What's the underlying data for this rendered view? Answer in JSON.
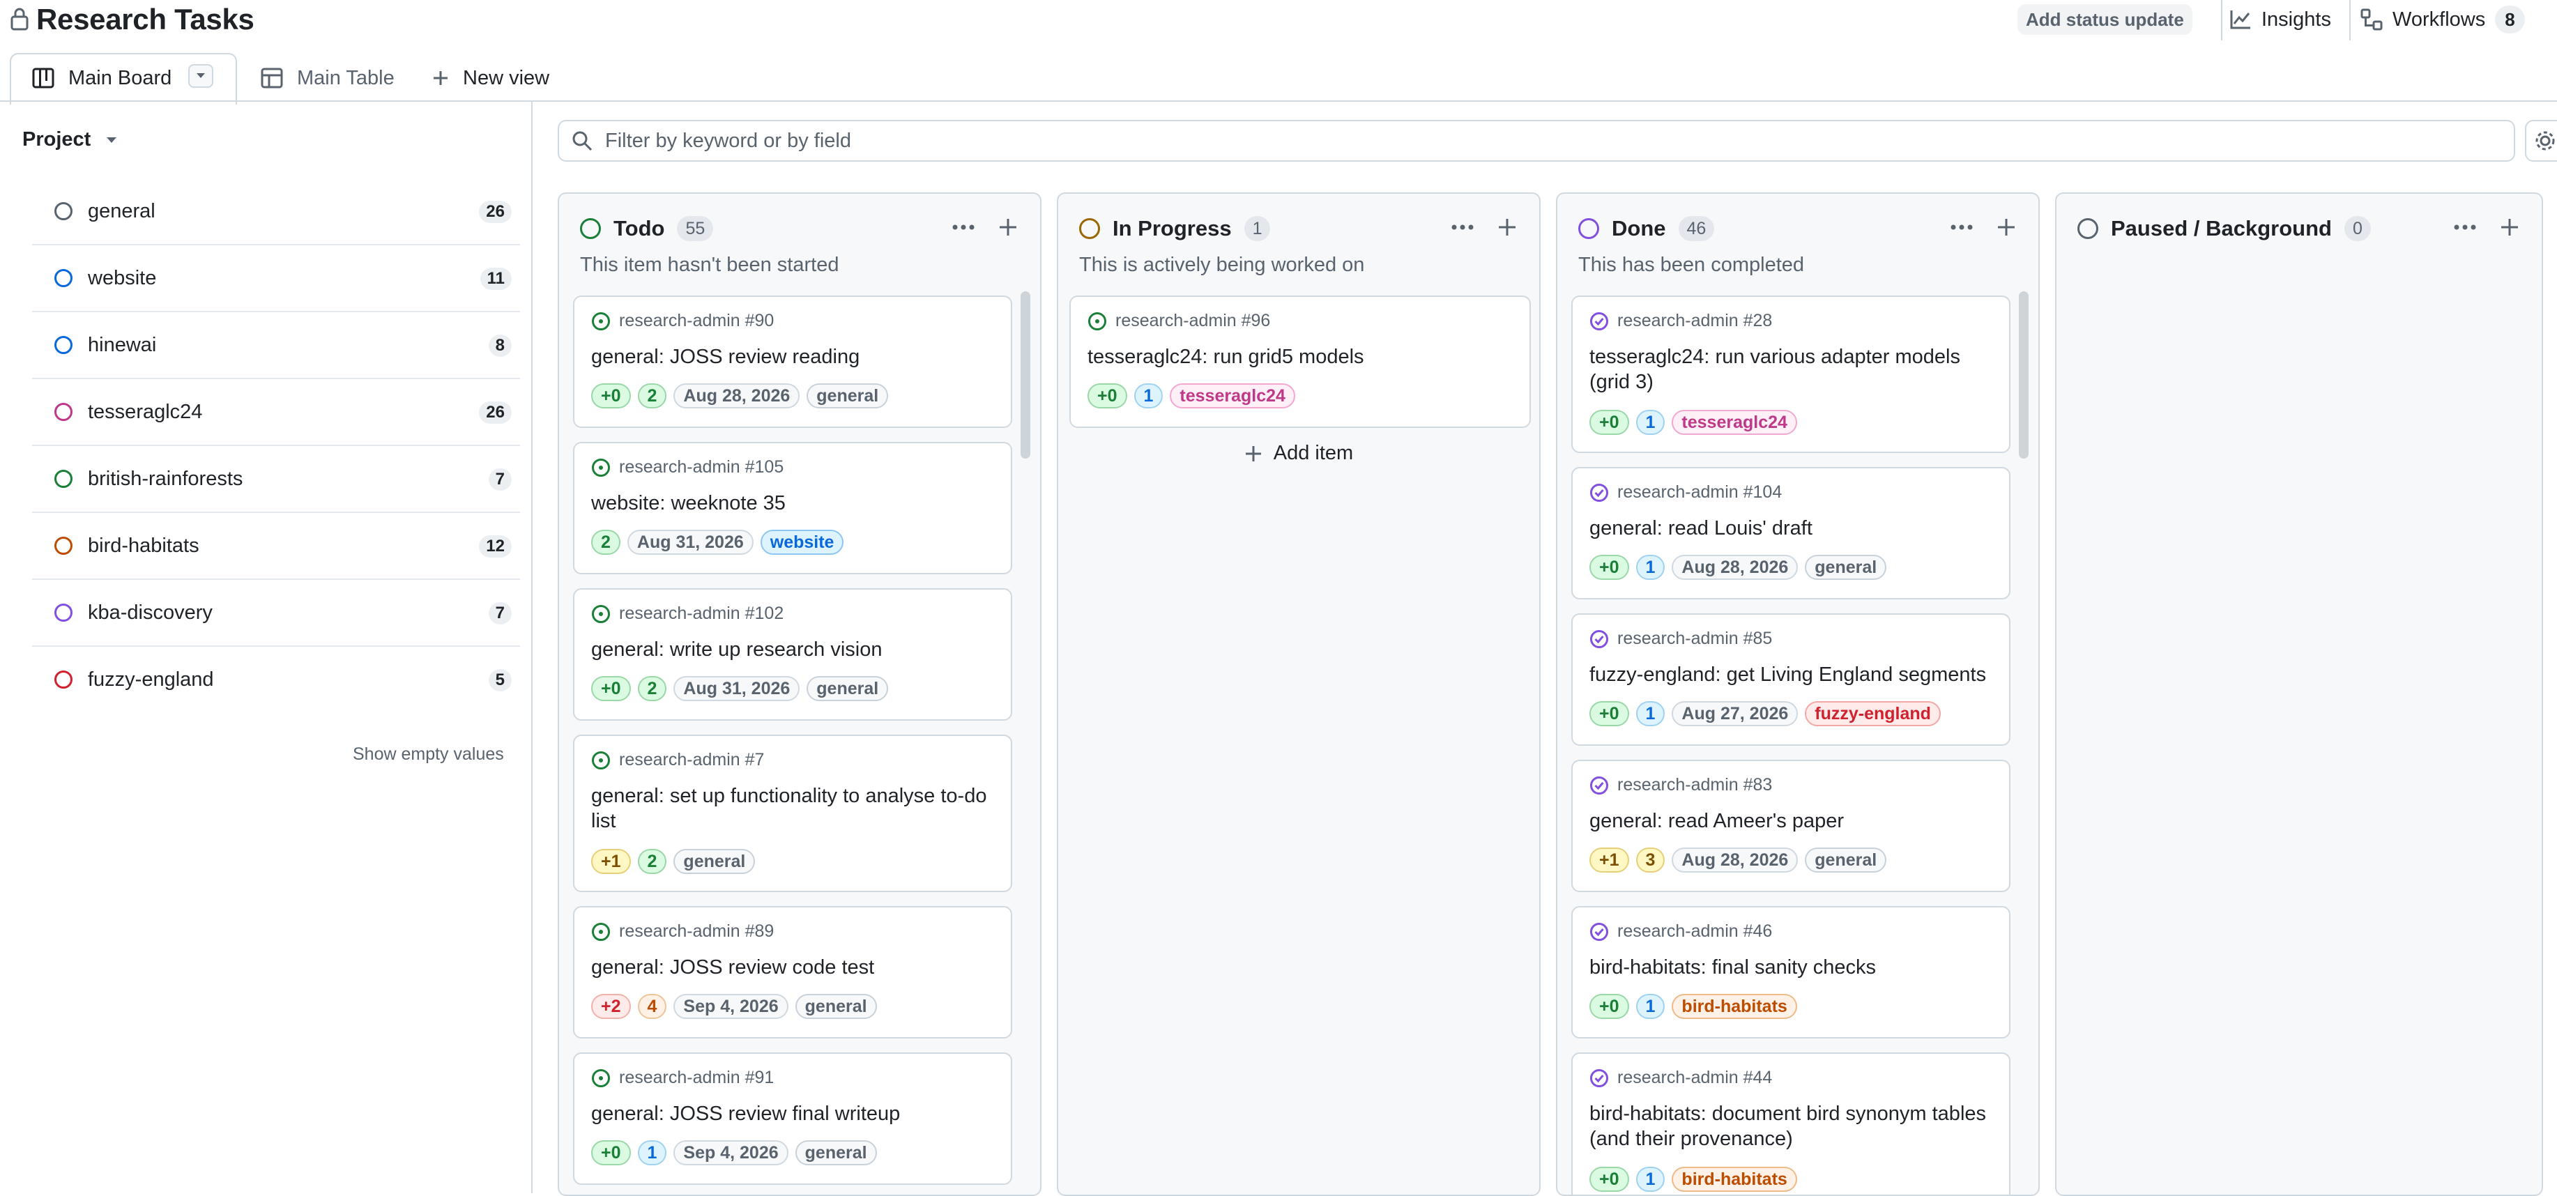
{
  "header": {
    "title": "Research Tasks",
    "status_update_label": "Add status update",
    "insights_label": "Insights",
    "workflows_label": "Workflows",
    "workflows_count": "8"
  },
  "tabs": [
    {
      "label": "Main Board"
    },
    {
      "label": "Main Table"
    },
    {
      "label": "New view"
    }
  ],
  "sidebar": {
    "group_label": "Project",
    "items": [
      {
        "label": "general",
        "count": "26",
        "color": "#59636e"
      },
      {
        "label": "website",
        "count": "11",
        "color": "#0969da"
      },
      {
        "label": "hinewai",
        "count": "8",
        "color": "#0969da"
      },
      {
        "label": "tesseraglc24",
        "count": "26",
        "color": "#bf3989"
      },
      {
        "label": "british-rainforests",
        "count": "7",
        "color": "#1a7f37"
      },
      {
        "label": "bird-habitats",
        "count": "12",
        "color": "#bc4c00"
      },
      {
        "label": "kba-discovery",
        "count": "7",
        "color": "#8250df"
      },
      {
        "label": "fuzzy-england",
        "count": "5",
        "color": "#cf222e"
      }
    ],
    "show_empty_label": "Show empty values"
  },
  "filter": {
    "placeholder": "Filter by keyword or by field"
  },
  "columns": [
    {
      "title": "Todo",
      "count": "55",
      "description": "This item hasn't been started",
      "color": "#1a7f37",
      "cards": [
        {
          "ref": "research-admin #90",
          "title": "general: JOSS review reading",
          "badges": [
            {
              "text": "+0",
              "style": "green"
            },
            {
              "text": "2",
              "style": "green"
            },
            {
              "text": "Aug 28, 2026",
              "style": "gray"
            },
            {
              "text": "general",
              "style": "general"
            }
          ]
        },
        {
          "ref": "research-admin #105",
          "title": "website: weeknote 35",
          "badges": [
            {
              "text": "2",
              "style": "green"
            },
            {
              "text": "Aug 31, 2026",
              "style": "gray"
            },
            {
              "text": "website",
              "style": "website"
            }
          ]
        },
        {
          "ref": "research-admin #102",
          "title": "general: write up research vision",
          "badges": [
            {
              "text": "+0",
              "style": "green"
            },
            {
              "text": "2",
              "style": "green"
            },
            {
              "text": "Aug 31, 2026",
              "style": "gray"
            },
            {
              "text": "general",
              "style": "general"
            }
          ]
        },
        {
          "ref": "research-admin #7",
          "title": "general: set up functionality to analyse to-do list",
          "badges": [
            {
              "text": "+1",
              "style": "yellow"
            },
            {
              "text": "2",
              "style": "green"
            },
            {
              "text": "general",
              "style": "general"
            }
          ]
        },
        {
          "ref": "research-admin #89",
          "title": "general: JOSS review code test",
          "badges": [
            {
              "text": "+2",
              "style": "red"
            },
            {
              "text": "4",
              "style": "orange"
            },
            {
              "text": "Sep 4, 2026",
              "style": "gray"
            },
            {
              "text": "general",
              "style": "general"
            }
          ]
        },
        {
          "ref": "research-admin #91",
          "title": "general: JOSS review final writeup",
          "badges": [
            {
              "text": "+0",
              "style": "green"
            },
            {
              "text": "1",
              "style": "blue"
            },
            {
              "text": "Sep 4, 2026",
              "style": "gray"
            },
            {
              "text": "general",
              "style": "general"
            }
          ]
        }
      ]
    },
    {
      "title": "In Progress",
      "count": "1",
      "description": "This is actively being worked on",
      "color": "#9a6700",
      "cards": [
        {
          "ref": "research-admin #96",
          "title": "tesseraglc24: run grid5 models",
          "badges": [
            {
              "text": "+0",
              "style": "green"
            },
            {
              "text": "1",
              "style": "blue"
            },
            {
              "text": "tesseraglc24",
              "style": "tess"
            }
          ]
        }
      ],
      "add_item_label": "Add item"
    },
    {
      "title": "Done",
      "count": "46",
      "description": "This has been completed",
      "color": "#8250df",
      "cards": [
        {
          "ref": "research-admin #28",
          "title": "tesseraglc24: run various adapter models (grid 3)",
          "badges": [
            {
              "text": "+0",
              "style": "green"
            },
            {
              "text": "1",
              "style": "blue"
            },
            {
              "text": "tesseraglc24",
              "style": "tess"
            }
          ]
        },
        {
          "ref": "research-admin #104",
          "title": "general: read Louis' draft",
          "badges": [
            {
              "text": "+0",
              "style": "green"
            },
            {
              "text": "1",
              "style": "blue"
            },
            {
              "text": "Aug 28, 2026",
              "style": "gray"
            },
            {
              "text": "general",
              "style": "general"
            }
          ]
        },
        {
          "ref": "research-admin #85",
          "title": "fuzzy-england: get Living England segments",
          "badges": [
            {
              "text": "+0",
              "style": "green"
            },
            {
              "text": "1",
              "style": "blue"
            },
            {
              "text": "Aug 27, 2026",
              "style": "gray"
            },
            {
              "text": "fuzzy-england",
              "style": "fuzzy"
            }
          ]
        },
        {
          "ref": "research-admin #83",
          "title": "general: read Ameer's paper",
          "badges": [
            {
              "text": "+1",
              "style": "yellow"
            },
            {
              "text": "3",
              "style": "yellow"
            },
            {
              "text": "Aug 28, 2026",
              "style": "gray"
            },
            {
              "text": "general",
              "style": "general"
            }
          ]
        },
        {
          "ref": "research-admin #46",
          "title": "bird-habitats: final sanity checks",
          "badges": [
            {
              "text": "+0",
              "style": "green"
            },
            {
              "text": "1",
              "style": "blue"
            },
            {
              "text": "bird-habitats",
              "style": "bird"
            }
          ]
        },
        {
          "ref": "research-admin #44",
          "title": "bird-habitats: document bird synonym tables (and their provenance)",
          "badges": [
            {
              "text": "+0",
              "style": "green"
            },
            {
              "text": "1",
              "style": "blue"
            },
            {
              "text": "bird-habitats",
              "style": "bird"
            }
          ]
        }
      ]
    },
    {
      "title": "Paused / Background",
      "count": "0",
      "description": "",
      "color": "#59636e",
      "cards": []
    }
  ]
}
